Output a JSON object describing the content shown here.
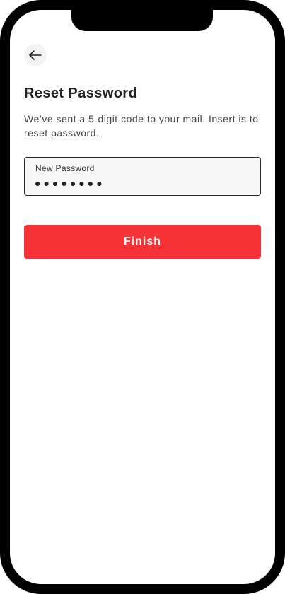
{
  "header": {
    "back_icon": "arrow-left-icon"
  },
  "content": {
    "title": "Reset Password",
    "description": "We’ve sent a 5-digit code to your mail. Insert is to reset password."
  },
  "form": {
    "password_label": "New Password",
    "password_value": "●●●●●●●●"
  },
  "actions": {
    "finish_label": "Finish"
  },
  "colors": {
    "primary": "#f53236",
    "frame": "#000000",
    "field_background": "#f7f7f7"
  }
}
